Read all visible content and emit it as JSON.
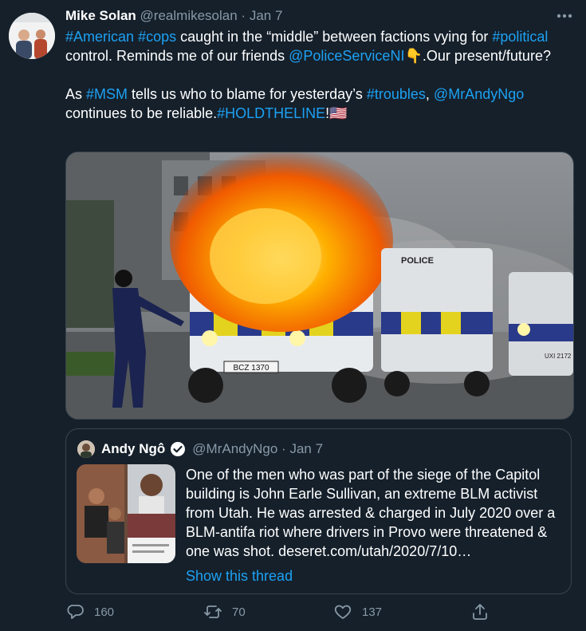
{
  "tweet": {
    "author_name": "Mike Solan",
    "handle": "@realmikesolan",
    "separator": "·",
    "date": "Jan 7",
    "text_line1_parts": {
      "h1": "#American",
      "h2": "#cops",
      "t1": " caught in the “middle” between factions vying for ",
      "h3": "#political",
      "t2": " control. Reminds me of our friends ",
      "m1": "@PoliceServiceNI",
      "emoji1": "👇",
      "t3": ".Our present/future?"
    },
    "text_line2_parts": {
      "t1": "As ",
      "h1": "#MSM",
      "t2": " tells us who to blame for yesterday’s ",
      "h2": "#troubles",
      "t3": ", ",
      "m1": "@MrAndyNgo",
      "t4": " continues to be reliable.",
      "h3": "#HOLDTHELINE",
      "t5": "!",
      "emoji2": "🇺🇸"
    },
    "media": {
      "vehicle_plate": "BCZ 1370",
      "vehicle_label": "POLICE",
      "vehicle3_plate": "UXI 2172"
    }
  },
  "quoted": {
    "author_name": "Andy Ngô",
    "handle": "@MrAndyNgo",
    "separator": "·",
    "date": "Jan 7",
    "text": "One of the men who was part of the siege of the Capitol building is John Earle Sullivan, an extreme BLM activist from Utah. He was arrested & charged in July 2020 over a BLM-antifa riot where drivers in Provo were threatened & one was shot. ",
    "link_text": "deseret.com/utah/2020/7/10…",
    "show_thread": "Show this thread"
  },
  "actions": {
    "reply_count": "160",
    "retweet_count": "70",
    "like_count": "137"
  },
  "colors": {
    "background": "#15202b",
    "link": "#1da1f2",
    "muted": "#8899a6",
    "border": "#38444d"
  }
}
